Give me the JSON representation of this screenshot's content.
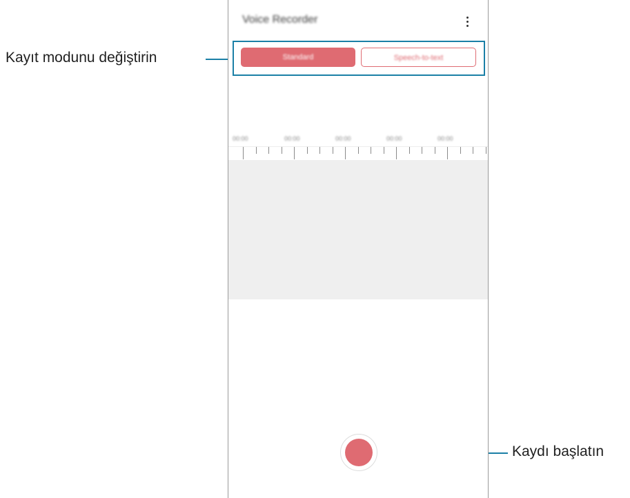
{
  "callouts": {
    "mode": "Kayıt modunu değiştirin",
    "record": "Kaydı başlatın"
  },
  "app": {
    "title": "Voice Recorder",
    "more_icon": "more-vertical-icon"
  },
  "modes": {
    "standard": "Standard",
    "speech_to_text": "Speech-to-text"
  },
  "timeline": {
    "labels": [
      "00:00",
      "00:00",
      "00:00",
      "00:00",
      "00:00"
    ]
  },
  "colors": {
    "accent": "#df6b72",
    "callout_line": "#1a7fa6",
    "wave_background": "#efefef"
  }
}
